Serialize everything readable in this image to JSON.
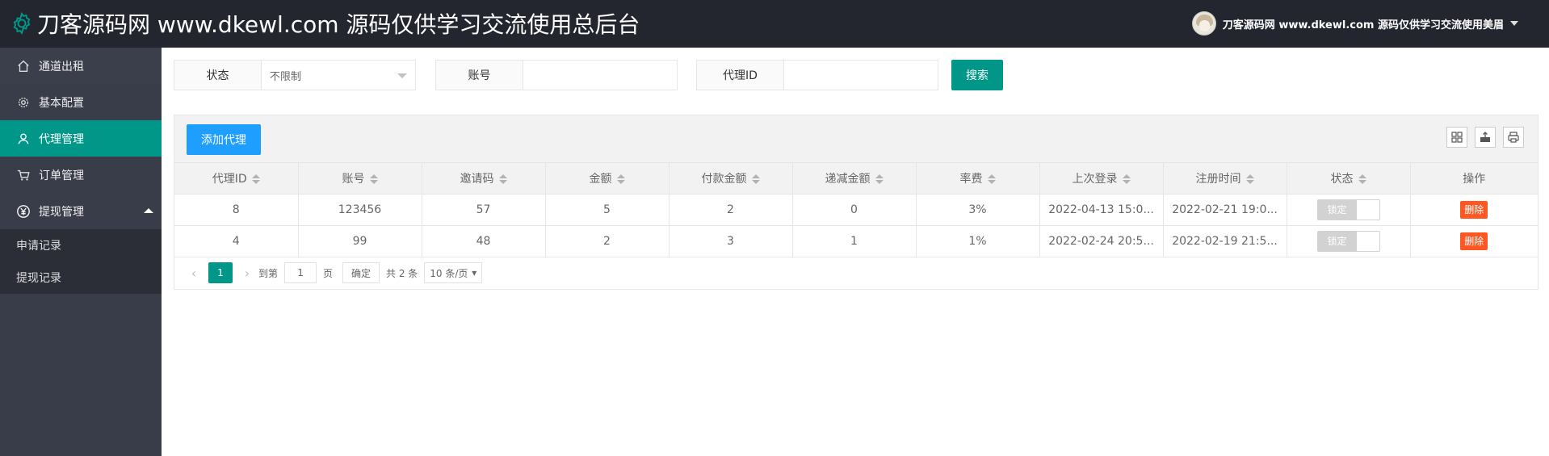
{
  "header": {
    "title": "刀客源码网 www.dkewl.com 源码仅供学习交流使用总后台",
    "user": "刀客源码网 www.dkewl.com 源码仅供学习交流使用美眉"
  },
  "sidebar": {
    "items": [
      {
        "label": "通道出租",
        "icon": "home-icon"
      },
      {
        "label": "基本配置",
        "icon": "gear-icon"
      },
      {
        "label": "代理管理",
        "icon": "user-icon"
      },
      {
        "label": "订单管理",
        "icon": "cart-icon"
      },
      {
        "label": "提现管理",
        "icon": "yen-icon"
      }
    ],
    "sub_items": [
      "申请记录",
      "提现记录"
    ]
  },
  "filters": {
    "status_label": "状态",
    "status_value": "不限制",
    "account_label": "账号",
    "account_value": "",
    "agent_label": "代理ID",
    "agent_value": "",
    "search_label": "搜索"
  },
  "toolbar": {
    "add_label": "添加代理"
  },
  "table": {
    "headers": [
      "代理ID",
      "账号",
      "邀请码",
      "金额",
      "付款金额",
      "递减金额",
      "率费",
      "上次登录",
      "注册时间",
      "状态",
      "操作"
    ],
    "rows": [
      {
        "id": "8",
        "account": "123456",
        "invite": "57",
        "amount": "5",
        "paid": "2",
        "decrease": "0",
        "rate": "3%",
        "last_login": "2022-04-13 15:0...",
        "register": "2022-02-21 19:0...",
        "status": "锁定",
        "action": "删除"
      },
      {
        "id": "4",
        "account": "99",
        "invite": "48",
        "amount": "2",
        "paid": "3",
        "decrease": "1",
        "rate": "1%",
        "last_login": "2022-02-24 20:5...",
        "register": "2022-02-19 21:5...",
        "status": "锁定",
        "action": "删除"
      }
    ]
  },
  "pager": {
    "current": "1",
    "goto_label": "到第",
    "page_value": "1",
    "page_unit": "页",
    "confirm": "确定",
    "total": "共 2 条",
    "per_page": "10 条/页"
  },
  "colors": {
    "header_bg": "#23262e",
    "sidebar_bg": "#393d49",
    "accent": "#009688",
    "blue": "#1e9fff",
    "danger": "#ff5722"
  }
}
